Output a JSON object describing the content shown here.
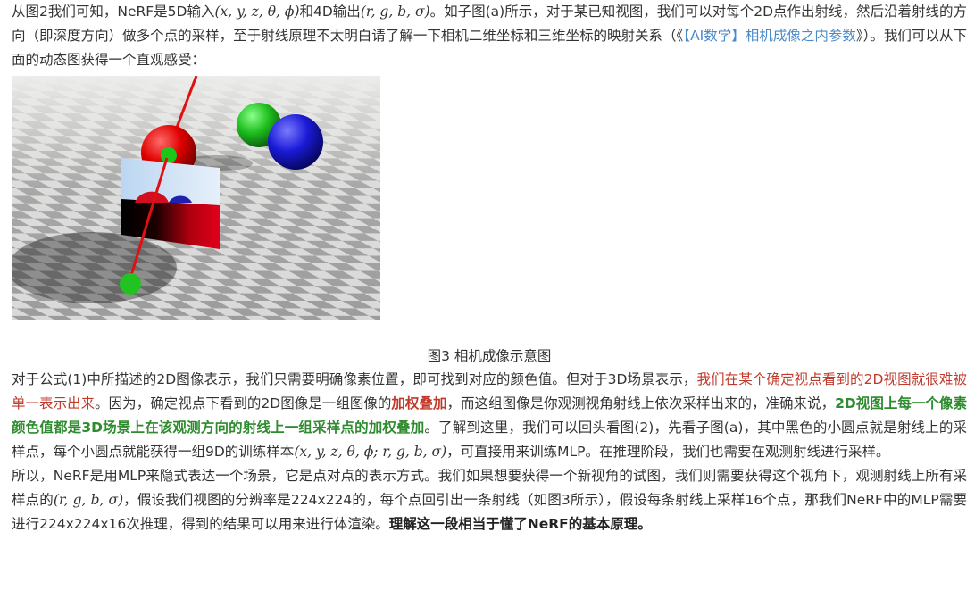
{
  "intro": {
    "p1_a": "从图2我们可知，NeRF是5D输入",
    "p1_math1": "(x, y, z, θ, ϕ)",
    "p1_b": "和4D输出",
    "p1_math2": "(r, g, b, σ)",
    "p1_c": "。如子图(a)所示，对于某已知视图，我们可以对每个2D点作出射线，然后沿着射线的方向（即深度方向）做多个点的采样，至于射线原理不太明白请了解一下相机二维坐标和三维坐标的映射关系（《",
    "p1_link": "【AI数学】相机成像之内参数",
    "p1_d": "》）。我们可以从下面的动态图获得一个直观感受："
  },
  "figure": {
    "caption": "图3 相机成像示意图"
  },
  "body1": {
    "a": "对于公式(1)中所描述的2D图像表示，我们只需要明确像素位置，即可找到对应的颜色值。但对于3D场景表示，",
    "red": "我们在某个确定视点看到的2D视图就很难被单一表示出来",
    "b": "。因为，确定视点下看到的2D图像是一组图像的",
    "bold_red": "加权叠加",
    "c": "，而这组图像是你观测视角射线上依次采样出来的，准确来说，",
    "bold_green": "2D视图上每一个像素颜色值都是3D场景上在该观测方向的射线上一组采样点的加权叠加",
    "d": "。了解到这里，我们可以回头看图(2)，先看子图(a)，其中黑色的小圆点就是射线上的采样点，每个小圆点就能获得一组9D的训练样本",
    "math": "(x, y, z, θ, ϕ; r, g, b, σ)",
    "e": "，可直接用来训练MLP。在推理阶段，我们也需要在观测射线进行采样。"
  },
  "body2": {
    "a": "所以，NeRF是用MLP来隐式表达一个场景，它是点对点的表示方式。我们如果想要获得一个新视角的试图，我们则需要获得这个视角下，观测射线上所有采样点的",
    "math": "(r, g, b, σ)",
    "b": "，假设我们视图的分辨率是224x224的，每个点回引出一条射线（如图3所示），假设每条射线上采样16个点，那我们NeRF中的MLP需要进行224x224x16次推理，得到的结果可以用来进行体渲染。",
    "bold": "理解这一段相当于懂了NeRF的基本原理。"
  }
}
